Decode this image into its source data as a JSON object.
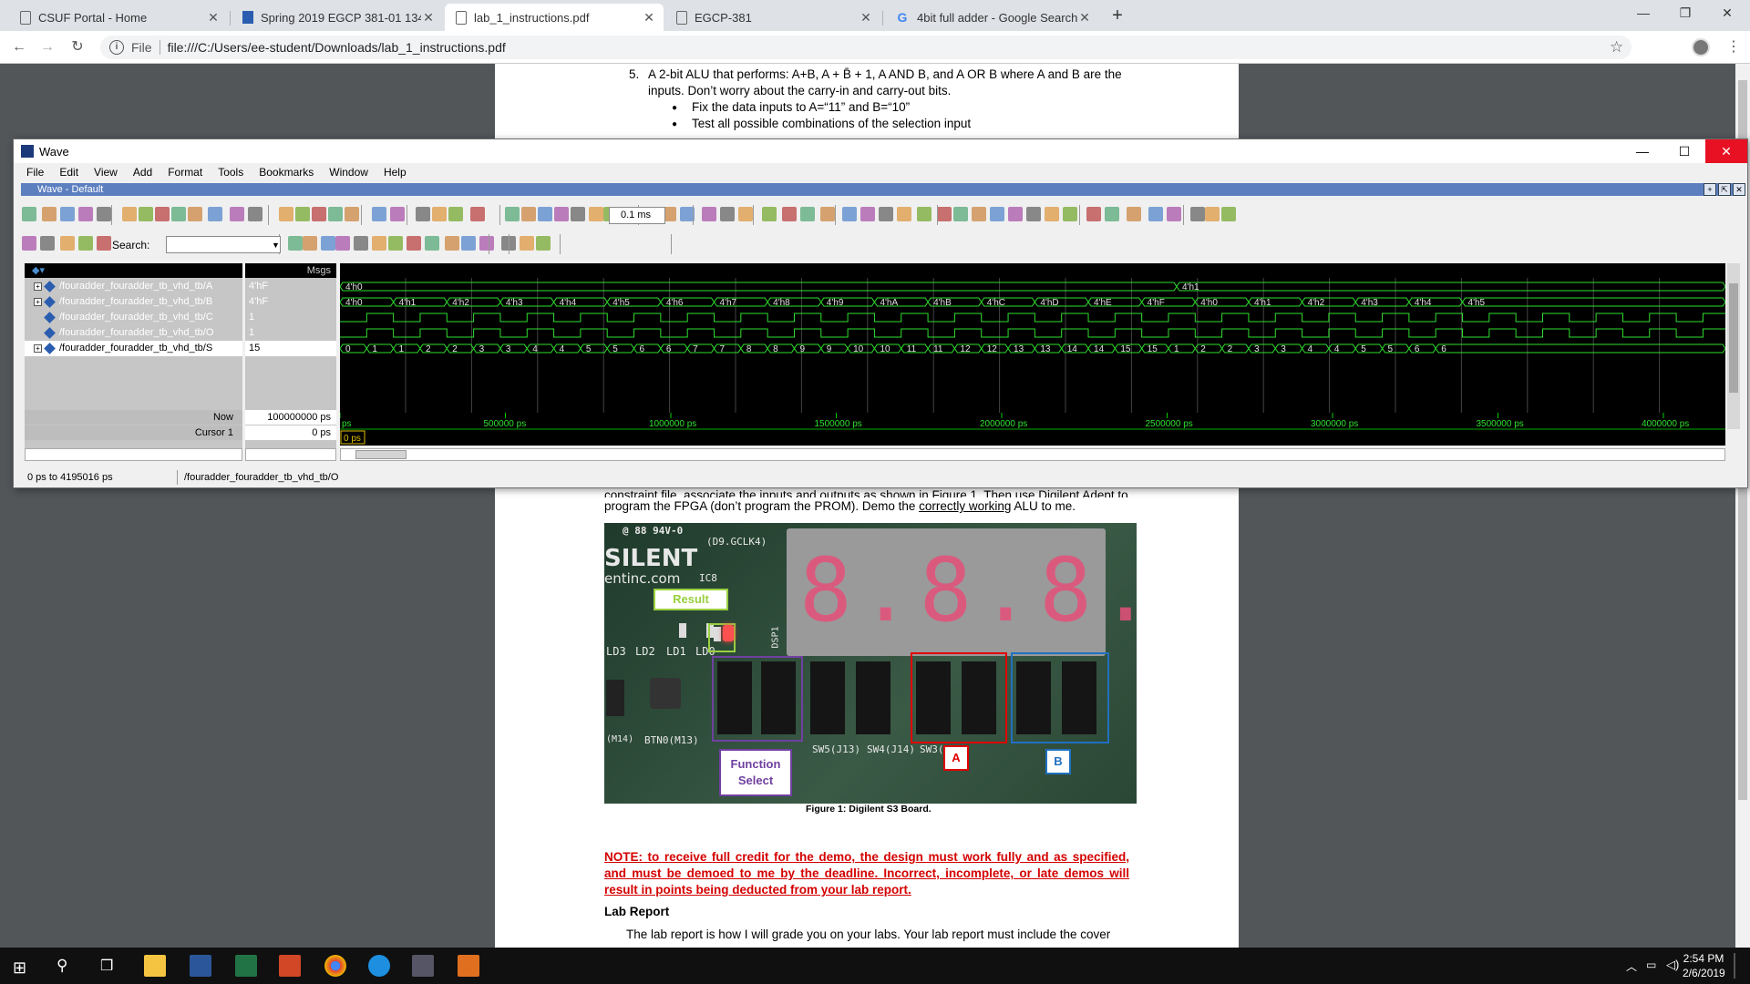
{
  "browser": {
    "tabs": [
      {
        "title": "CSUF Portal - Home"
      },
      {
        "title": "Spring 2019 EGCP 381-01 13458"
      },
      {
        "title": "lab_1_instructions.pdf"
      },
      {
        "title": "EGCP-381"
      },
      {
        "title": "4bit full adder - Google Search"
      }
    ],
    "url_scheme": "File",
    "url": "file:///C:/Users/ee-student/Downloads/lab_1_instructions.pdf"
  },
  "pdf": {
    "item5_num": "5.",
    "item5_line1": "A 2-bit ALU that performs: A+B, A + B̄ + 1, A AND B, and A OR B where A and B are the",
    "item5_line2": "inputs. Don’t worry about the carry-in and carry-out bits.",
    "bullet1": "Fix the data inputs to A=“11” and B=“10”",
    "bullet2": "Test all possible combinations of the selection input",
    "partial_line": "constraint file, associate the inputs and outputs as shown in Figure 1. Then use Digilent Adept to",
    "program_line_a": "program the FPGA (don’t program the PROM). Demo the ",
    "program_line_link": "correctly working",
    "program_line_b": " ALU to me.",
    "board_labels": {
      "result": "Result",
      "function_select": "Function Select",
      "a": "A",
      "b": "B"
    },
    "board_text": [
      "SILENT",
      "entinc.com",
      "IC8",
      "DSP1",
      "LD3",
      "LD2",
      "LD1",
      "LD0",
      "BTN0(M13)",
      "SW5(J13)",
      "SW4(J14)",
      "SW3(",
      "(M14)",
      "(D9.GCLK4)",
      "@ 88 94V-0"
    ],
    "figure_caption": "Figure 1: Digilent S3 Board.",
    "note": "NOTE: to receive full credit for the demo, the design must work fully and as specified, and must be demoed to me by the deadline. Incorrect, incomplete, or late demos will result in points being deducted from your lab report.",
    "lab_report_heading": "Lab Report",
    "lab_report_text": "The lab report is how I will grade you on your labs. Your lab report must include the cover"
  },
  "wave": {
    "title": "Wave",
    "menu": [
      "File",
      "Edit",
      "View",
      "Add",
      "Format",
      "Tools",
      "Bookmarks",
      "Window",
      "Help"
    ],
    "subtitle": "Wave - Default",
    "time_field": "0.1 ms",
    "search_label": "Search:",
    "msgs_header": "Msgs",
    "signals": [
      {
        "name": "/fouradder_fouradder_tb_vhd_tb/A",
        "value": "4'hF",
        "expandable": true
      },
      {
        "name": "/fouradder_fouradder_tb_vhd_tb/B",
        "value": "4'hF",
        "expandable": true
      },
      {
        "name": "/fouradder_fouradder_tb_vhd_tb/C",
        "value": "1",
        "expandable": false
      },
      {
        "name": "/fouradder_fouradder_tb_vhd_tb/O",
        "value": "1",
        "expandable": false
      },
      {
        "name": "/fouradder_fouradder_tb_vhd_tb/S",
        "value": "15",
        "expandable": true
      }
    ],
    "a_labels": [
      "4'h0",
      "4'h1"
    ],
    "b_labels": [
      "4'h0",
      "4'h1",
      "4'h2",
      "4'h3",
      "4'h4",
      "4'h5",
      "4'h6",
      "4'h7",
      "4'h8",
      "4'h9",
      "4'hA",
      "4'hB",
      "4'hC",
      "4'hD",
      "4'hE",
      "4'hF",
      "4'h0",
      "4'h1",
      "4'h2",
      "4'h3",
      "4'h4",
      "4'h5"
    ],
    "s_labels": [
      "0",
      "1",
      "1",
      "2",
      "2",
      "3",
      "3",
      "4",
      "4",
      "5",
      "5",
      "6",
      "6",
      "7",
      "7",
      "8",
      "8",
      "9",
      "9",
      "10",
      "10",
      "11",
      "11",
      "12",
      "12",
      "13",
      "13",
      "14",
      "14",
      "15",
      "15",
      "1",
      "2",
      "2",
      "3",
      "3",
      "4",
      "4",
      "5",
      "5",
      "6",
      "6"
    ],
    "now_label": "Now",
    "now_value": "100000000 ps",
    "cursor_label": "Cursor 1",
    "cursor_value": "0 ps",
    "cursor_tag": "0 ps",
    "ruler_labels": [
      "ps",
      "500000 ps",
      "1000000 ps",
      "1500000 ps",
      "2000000 ps",
      "2500000 ps",
      "3000000 ps",
      "3500000 ps",
      "4000000 ps"
    ],
    "status_range": "0 ps to 4195016 ps",
    "status_path": "/fouradder_fouradder_tb_vhd_tb/O"
  },
  "taskbar": {
    "time": "2:54 PM",
    "date": "2/6/2019"
  }
}
